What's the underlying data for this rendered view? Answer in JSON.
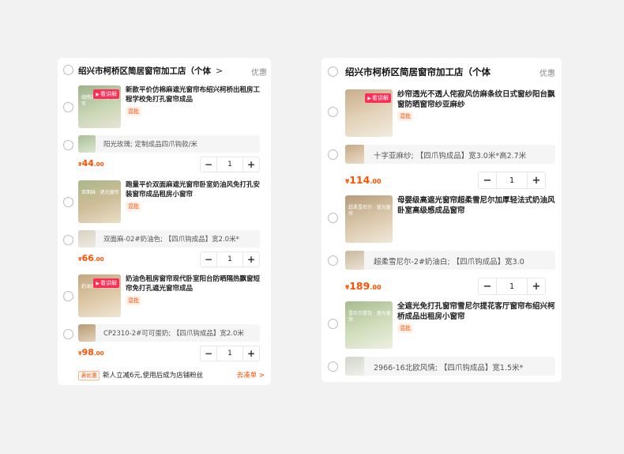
{
  "left": {
    "shop": {
      "name": "绍兴市柯桥区简居窗帘加工店（个体",
      "promo_label": "优惠"
    },
    "items": [
      {
        "title": "新款平价仿棉麻遮光窗帘布绍兴柯桥出租房工程学校免打孔窗帘成品",
        "tag": "混批",
        "live": "看讲解",
        "caption": "绒感风格 · 遮光窗帘",
        "sku": "阳光玫瑰; 定制成品四爪钩款/米",
        "price_int": "44",
        "price_dec": ".00",
        "qty": "1"
      },
      {
        "title": "跑量平价双面麻遮光窗帘卧室奶油风免打孔安装窗帘成品租房小窗帘",
        "tag": "混批",
        "live": "",
        "caption": "双面麻 · 遮光窗帘",
        "sku": "双面麻-02#奶油色; 【四爪钩成品】宽2.0米*",
        "price_int": "66",
        "price_dec": ".00",
        "qty": "1"
      },
      {
        "title": "奶油色租房窗帘现代卧室阳台防晒隔热飘窗短帘免打孔遮光窗帘成品",
        "tag": "混批",
        "live": "看讲解",
        "caption": "奶油风 · 遮光窗帘",
        "sku": "CP2310-2#可可蛋奶; 【四爪钩成品】宽2.0米",
        "price_int": "98",
        "price_dec": ".00",
        "qty": "1"
      }
    ],
    "footer": {
      "badge": "满优惠",
      "text": "新人立减6元,使用后成为店铺粉丝",
      "link": "去凑单 >"
    }
  },
  "right": {
    "shop": {
      "name": "绍兴市柯桥区简居窗帘加工店（个体",
      "promo_label": "优惠"
    },
    "items": [
      {
        "title": "纱帘透光不透人侘寂风仿麻条纹日式窗纱阳台飘窗防晒窗帘纱亚麻纱",
        "tag": "混批",
        "live": "看讲解",
        "caption": "",
        "sku": "十字亚麻纱; 【四爪钩成品】宽3.0米*高2.7米",
        "price_int": "114",
        "price_dec": ".00",
        "qty": "1"
      },
      {
        "title": "母婴级高遮光窗帘超柔雪尼尔加厚轻法式奶油风卧室高级感成品窗帘",
        "tag": "",
        "live": "",
        "caption": "超柔雪尼尔 · 遮光窗帘",
        "sku": "超柔雪尼尔-2#奶油白; 【四爪钩成品】宽3.0",
        "price_int": "189",
        "price_dec": ".00",
        "qty": "1"
      },
      {
        "title": "全遮光免打孔窗帘雪尼尔提花客厅窗帘布绍兴柯桥成品出租房小窗帘",
        "tag": "混批",
        "live": "",
        "caption": "雪尼尔提花 · 遮光窗帘",
        "sku": "2966-16北欧风情; 【四爪钩成品】宽1.5米*",
        "price_int": "",
        "price_dec": "",
        "qty": ""
      }
    ]
  },
  "common": {
    "currency": "¥",
    "minus": "−",
    "plus": "+",
    "chevron": ">"
  },
  "colors": {
    "accent": "#ff5000",
    "live": "#ff2d55",
    "thumb_green": "#8fa87c",
    "thumb_beige": "#c9b49a"
  }
}
